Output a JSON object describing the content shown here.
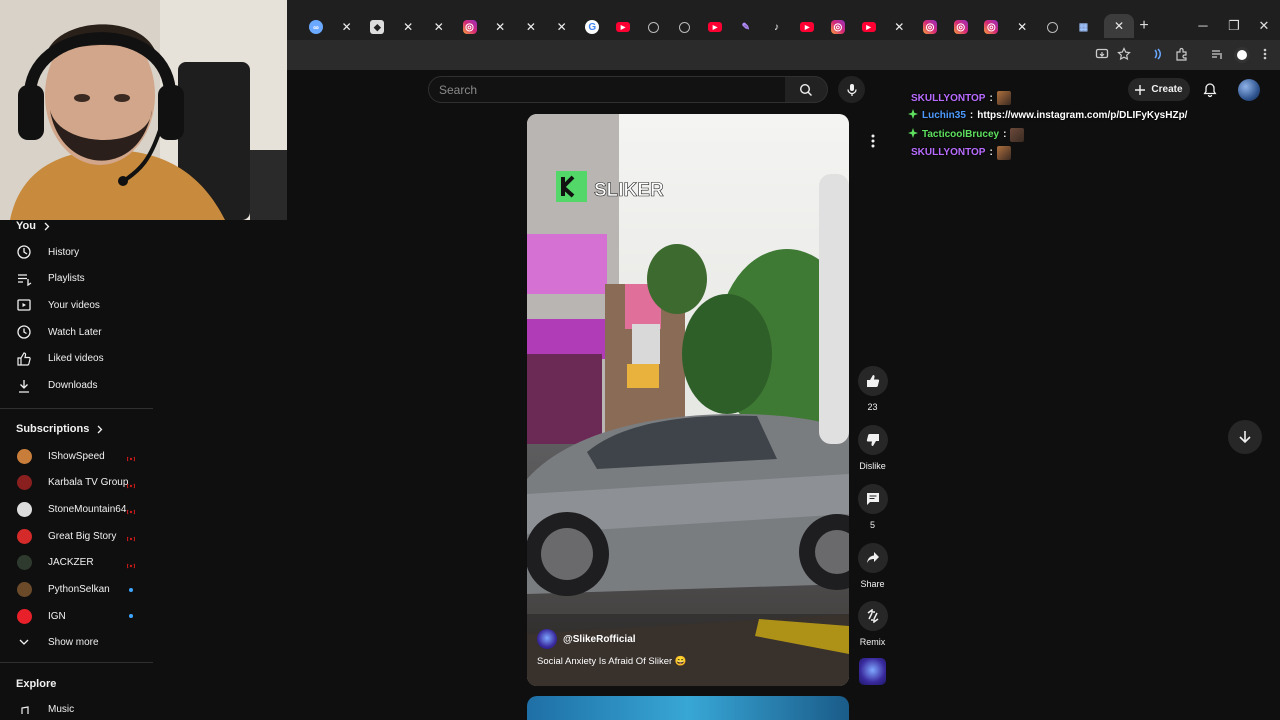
{
  "browser": {
    "tabs": [
      {
        "icon": "cpl"
      },
      {
        "icon": "x"
      },
      {
        "icon": "ghost"
      },
      {
        "icon": "x"
      },
      {
        "icon": "x"
      },
      {
        "icon": "ig"
      },
      {
        "icon": "x"
      },
      {
        "icon": "x"
      },
      {
        "icon": "x"
      },
      {
        "icon": "g"
      },
      {
        "icon": "yt"
      },
      {
        "icon": "web"
      },
      {
        "icon": "web"
      },
      {
        "icon": "yt"
      },
      {
        "icon": "feather"
      },
      {
        "icon": "tt"
      },
      {
        "icon": "yt"
      },
      {
        "icon": "ig"
      },
      {
        "icon": "yt"
      },
      {
        "icon": "x"
      },
      {
        "icon": "ig"
      },
      {
        "icon": "ig"
      },
      {
        "icon": "ig"
      },
      {
        "icon": "x"
      },
      {
        "icon": "web"
      },
      {
        "icon": "bs"
      }
    ],
    "active_tab_close": "✕",
    "new_tab": "+",
    "window_controls": {
      "minimize": "─",
      "restore": "❐",
      "close": "✕"
    }
  },
  "masthead": {
    "search_placeholder": "Search",
    "create_label": "Create"
  },
  "sidebar": {
    "you_heading": "You",
    "you_items": [
      {
        "label": "History",
        "icon": "history-icon"
      },
      {
        "label": "Playlists",
        "icon": "playlists-icon"
      },
      {
        "label": "Your videos",
        "icon": "your-videos-icon"
      },
      {
        "label": "Watch Later",
        "icon": "watch-later-icon"
      },
      {
        "label": "Liked videos",
        "icon": "liked-videos-icon"
      },
      {
        "label": "Downloads",
        "icon": "downloads-icon"
      }
    ],
    "subscriptions_heading": "Subscriptions",
    "subscriptions": [
      {
        "name": "IShowSpeed",
        "indicator": "live",
        "avatar_color": "#c97d3a"
      },
      {
        "name": "Karbala TV Group",
        "indicator": "live",
        "avatar_color": "#8a1f1f"
      },
      {
        "name": "StoneMountain64",
        "indicator": "live",
        "avatar_color": "#dddddd"
      },
      {
        "name": "Great Big Story",
        "indicator": "live",
        "avatar_color": "#d42a2a"
      },
      {
        "name": "JACKZER",
        "indicator": "live",
        "avatar_color": "#2f3a2f"
      },
      {
        "name": "PythonSelkan",
        "indicator": "new",
        "avatar_color": "#6b4a2a"
      },
      {
        "name": "IGN",
        "indicator": "new",
        "avatar_color": "#e8202a"
      }
    ],
    "show_more": "Show more",
    "explore_heading": "Explore",
    "explore_first": "Music"
  },
  "short": {
    "watermark": "SLIKER",
    "channel": "@SlikeRofficial",
    "title": "Social Anxiety Is Afraid Of Sliker 😄",
    "actions": {
      "like_count": "23",
      "dislike_label": "Dislike",
      "comment_count": "5",
      "share_label": "Share",
      "remix_label": "Remix"
    }
  },
  "chat": [
    {
      "user": "SKULLYONTOP",
      "color": "#b86cff",
      "text": "",
      "emote": true,
      "badge": false
    },
    {
      "user": "Luchin35",
      "color": "#4d9bff",
      "text": "https://www.instagram.com/p/DLIFyKysHZp/",
      "emote": false,
      "badge": true
    },
    {
      "user": "TacticoolBrucey",
      "color": "#5ee05e",
      "text": "",
      "emote": true,
      "badge": true
    },
    {
      "user": "SKULLYONTOP",
      "color": "#b86cff",
      "text": "",
      "emote": true,
      "badge": false
    }
  ],
  "colors": {
    "background": "#0f0f0f",
    "live_indicator": "#cc1a1a",
    "new_indicator": "#3ea6ff",
    "badge_green": "#5ee05e"
  }
}
